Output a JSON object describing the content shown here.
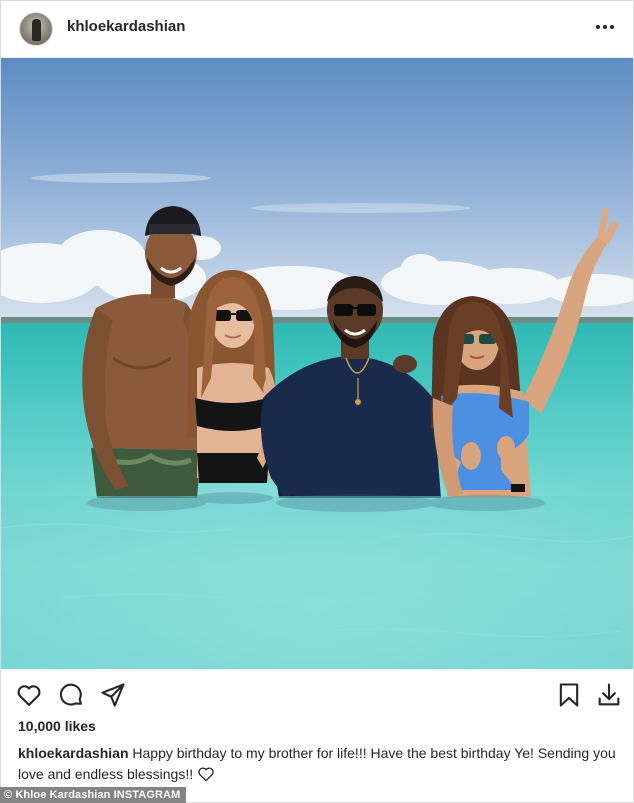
{
  "header": {
    "username": "khloekardashian",
    "more_icon": "more-horizontal-icon"
  },
  "photo": {
    "description_icon": "beach-photo"
  },
  "actions": {
    "like_icon": "heart-icon",
    "comment_icon": "comment-icon",
    "share_icon": "share-icon",
    "save_icon": "bookmark-icon",
    "download_icon": "download-icon"
  },
  "likes": "10,000 likes",
  "caption": {
    "username": "khloekardashian",
    "text": "Happy birthday to my brother for life!!! Have the best birthday Ye! Sending you love and endless blessings!!"
  },
  "credit": "© Khloe Kardashian INSTAGRAM",
  "colors": {
    "text": "#262626",
    "sea": "#5ccdc6",
    "sky": "#6e9bcc"
  }
}
